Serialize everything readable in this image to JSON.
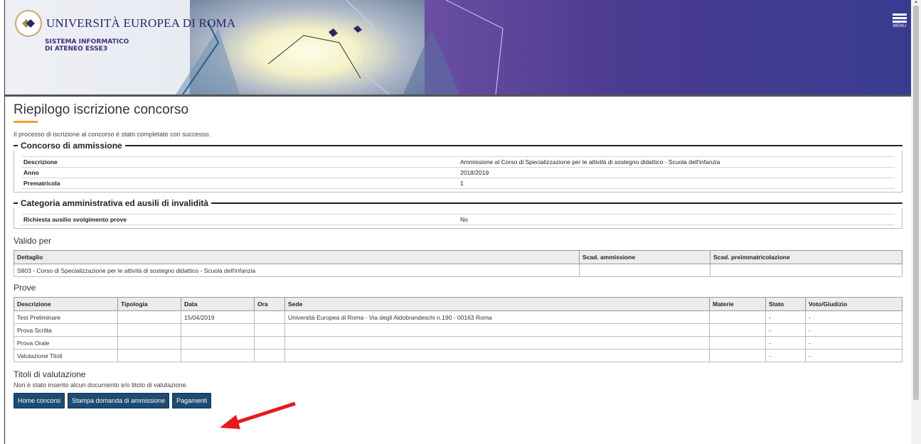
{
  "header": {
    "university_name": "UNIVERSITÀ EUROPEA DI ROMA",
    "system_line1": "SISTEMA INFORMATICO",
    "system_line2": "DI ATENEO ESSE3",
    "menu_label": "MENU"
  },
  "page": {
    "title": "Riepilogo iscrizione concorso",
    "message": "Il processo di iscrizione al concorso è stato completato con successo."
  },
  "concorso": {
    "heading": "Concorso di ammissione",
    "rows": [
      {
        "label": "Descrizione",
        "value": "Ammissione al Corso di Specializzazione per le attività di sostegno didattico - Scuola dell'infanzia"
      },
      {
        "label": "Anno",
        "value": "2018/2019"
      },
      {
        "label": "Prematricola",
        "value": "1"
      }
    ]
  },
  "categoria": {
    "heading": "Categoria amministrativa ed ausili di invalidità",
    "rows": [
      {
        "label": "Richiesta ausilio svolgimento prove",
        "value": "No"
      }
    ]
  },
  "valido_per": {
    "heading": "Valido per",
    "columns": [
      "Dettaglio",
      "Scad. ammissione",
      "Scad. preimmatricolazione"
    ],
    "rows": [
      [
        "S803 - Corso di Specializzazione per le attività di sostegno didattico - Scuola dell'infanzia",
        "",
        ""
      ]
    ]
  },
  "prove": {
    "heading": "Prove",
    "columns": [
      "Descrizione",
      "Tipologia",
      "Data",
      "Ora",
      "Sede",
      "Materie",
      "Stato",
      "Voto/Giudizio"
    ],
    "rows": [
      [
        "Test Preliminare",
        "",
        "15/04/2019",
        "",
        "Università Europea di Roma - Via degli Aldobrandeschi n.190 - 00163 Roma",
        "",
        "-",
        "-"
      ],
      [
        "Prova Scritta",
        "",
        "",
        "",
        "",
        "",
        "-",
        "-"
      ],
      [
        "Prova Orale",
        "",
        "",
        "",
        "",
        "",
        "-",
        "-"
      ],
      [
        "Valutazione Titoli",
        "",
        "",
        "",
        "",
        "",
        "-",
        "-"
      ]
    ]
  },
  "titoli": {
    "heading": "Titoli di valutazione",
    "message": "Non è stato inserito alcun documento e/o titolo di valutazione."
  },
  "buttons": {
    "home": "Home concorsi",
    "stampa": "Stampa domanda di ammissione",
    "pagamenti": "Pagamenti"
  },
  "colors": {
    "button_bg": "#1d4b72",
    "accent_underline": "#f0a030",
    "header_purple": "#4b3b91",
    "annotation_arrow": "#e8191c"
  }
}
